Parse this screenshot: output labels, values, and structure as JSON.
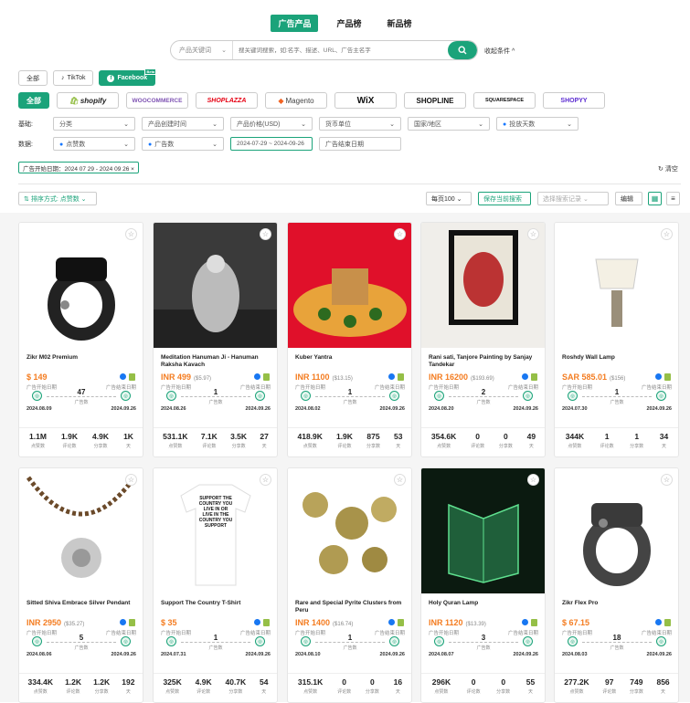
{
  "tabs": [
    "广告产品",
    "产品榜",
    "新品榜"
  ],
  "search": {
    "type": "产品关键词",
    "placeholder": "搜关键词搜索，如:名字、描述、URL、广告主名字",
    "collapse": "收起条件 ^"
  },
  "channels": [
    "全部",
    "TikTok",
    "Facebook"
  ],
  "beta": "Beta",
  "platforms": [
    "全部",
    "shopify",
    "WOOCOMMERCE",
    "SHOPLAZZA",
    "Magento",
    "WiX",
    "SHOPLINE",
    "SQUARESPACE",
    "SHOPYY"
  ],
  "filters": {
    "basic_label": "基础:",
    "basic": [
      "分类",
      "产品创建时间",
      "产品价格(USD)",
      "货币单位",
      "国家/地区",
      "投放天数"
    ],
    "data_label": "数据:",
    "data": [
      "点赞数",
      "广告数",
      "2024-07-29  ~  2024-09-26",
      "广告结束日期"
    ]
  },
  "active_tag": "广告开始日期：2024 07 29 - 2024 09 26  ×",
  "clear": "清空",
  "sort": "排序方式: 点赞数",
  "page_size": "每页100",
  "save_search": "保存当前搜索",
  "select_record": "选择搜索记录",
  "edit": "编辑",
  "labels": {
    "start": "广告开始日期",
    "end": "广告结束日期",
    "ads": "广告数",
    "likes": "点赞数",
    "comments": "评论数",
    "shares": "分享数",
    "days": "天"
  },
  "products": [
    {
      "title": "Zikr M02 Premium",
      "price": "$ 149",
      "usd": "",
      "fb": true,
      "ads": "47",
      "d1": "2024.08.09",
      "d2": "2024.09.26",
      "stats": [
        "1.1M",
        "1.9K",
        "4.9K",
        "1K"
      ],
      "bg": "#ffffff"
    },
    {
      "title": "Meditation Hanuman Ji - Hanuman Raksha Kavach",
      "price": "INR 499",
      "usd": "($5.97)",
      "fb": true,
      "ads": "1",
      "d1": "2024.08.26",
      "d2": "2024.09.26",
      "stats": [
        "531.1K",
        "7.1K",
        "3.5K",
        "27"
      ],
      "bg": "#3a3a3a"
    },
    {
      "title": "Kuber Yantra",
      "price": "INR 1100",
      "usd": "($13.15)",
      "fb": true,
      "ads": "1",
      "d1": "2024.08.02",
      "d2": "2024.09.26",
      "stats": [
        "418.9K",
        "1.9K",
        "875",
        "53"
      ],
      "bg": "#e0102a"
    },
    {
      "title": "Rani sati, Tanjore Painting by Sanjay Tandekar",
      "price": "INR 16200",
      "usd": "($193.69)",
      "fb": true,
      "ads": "2",
      "d1": "2024.08.20",
      "d2": "2024.09.26",
      "stats": [
        "354.6K",
        "0",
        "0",
        "49"
      ],
      "bg": "#f0eeea"
    },
    {
      "title": "Roshdy Wall Lamp",
      "price": "SAR 585.01",
      "usd": "($156)",
      "fb": true,
      "ads": "1",
      "d1": "2024.07.30",
      "d2": "2024.09.26",
      "stats": [
        "344K",
        "1",
        "1",
        "34"
      ],
      "bg": "#ffffff"
    },
    {
      "title": "Sitted Shiva Embrace Silver Pendant",
      "price": "INR 2950",
      "usd": "($35.27)",
      "fb": true,
      "ads": "5",
      "d1": "2024.08.06",
      "d2": "2024.09.26",
      "stats": [
        "334.4K",
        "1.2K",
        "1.2K",
        "192"
      ],
      "bg": "#ffffff"
    },
    {
      "title": "Support The Country T-Shirt",
      "price": "$ 35",
      "usd": "",
      "fb": true,
      "ads": "1",
      "d1": "2024.07.31",
      "d2": "2024.09.26",
      "stats": [
        "325K",
        "4.9K",
        "40.7K",
        "54"
      ],
      "bg": "#ffffff"
    },
    {
      "title": "Rare and Special Pyrite Clusters from Peru",
      "price": "INR 1400",
      "usd": "($16.74)",
      "fb": true,
      "ads": "1",
      "d1": "2024.08.10",
      "d2": "2024.09.26",
      "stats": [
        "315.1K",
        "0",
        "0",
        "16"
      ],
      "bg": "#ffffff"
    },
    {
      "title": "Holy Quran Lamp",
      "price": "INR 1120",
      "usd": "($13.39)",
      "fb": true,
      "ads": "3",
      "d1": "2024.08.07",
      "d2": "2024.09.26",
      "stats": [
        "296K",
        "0",
        "0",
        "55"
      ],
      "bg": "#0b1a10"
    },
    {
      "title": "Zikr Flex Pro",
      "price": "$ 67.15",
      "usd": "",
      "fb": true,
      "ads": "18",
      "d1": "2024.08.03",
      "d2": "2024.09.26",
      "stats": [
        "277.2K",
        "97",
        "749",
        "856"
      ],
      "bg": "#ffffff"
    }
  ],
  "tshirt_text": "SUPPORT THE COUNTRY YOU LIVE IN OR LIVE IN THE COUNTRY YOU SUPPORT"
}
